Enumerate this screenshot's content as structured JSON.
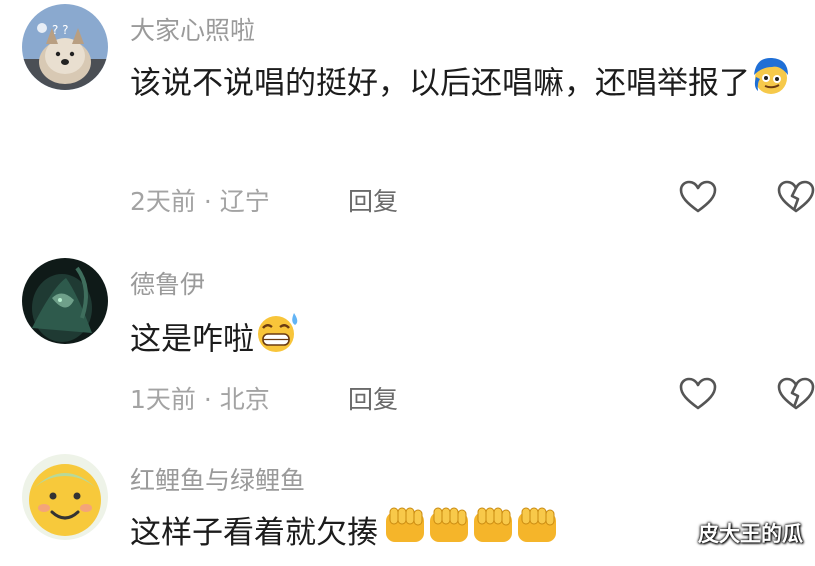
{
  "comments": [
    {
      "username": "大家心照啦",
      "text": "该说不说唱的挺好，以后还唱嘛，还唱举报了",
      "emoji": "blue-hair-face-emoji",
      "time": "2天前",
      "location": "· 辽宁",
      "reply_label": "回复",
      "avatar": "dog-avatar"
    },
    {
      "username": "德鲁伊",
      "text": "这是咋啦",
      "emoji": "grinning-sweat-emoji",
      "time": "1天前",
      "location": "· 北京",
      "reply_label": "回复",
      "avatar": "dark-character-avatar"
    },
    {
      "username": "红鲤鱼与绿鲤鱼",
      "text": "这样子看着就欠揍",
      "emoji": "fist-emoji",
      "avatar": "smiley-avatar"
    }
  ],
  "watermark": "皮大王的瓜",
  "colors": {
    "username": "#9a9a9a",
    "meta": "#a3a3a3",
    "text": "#1c1c1c",
    "icon_stroke": "#555555"
  }
}
